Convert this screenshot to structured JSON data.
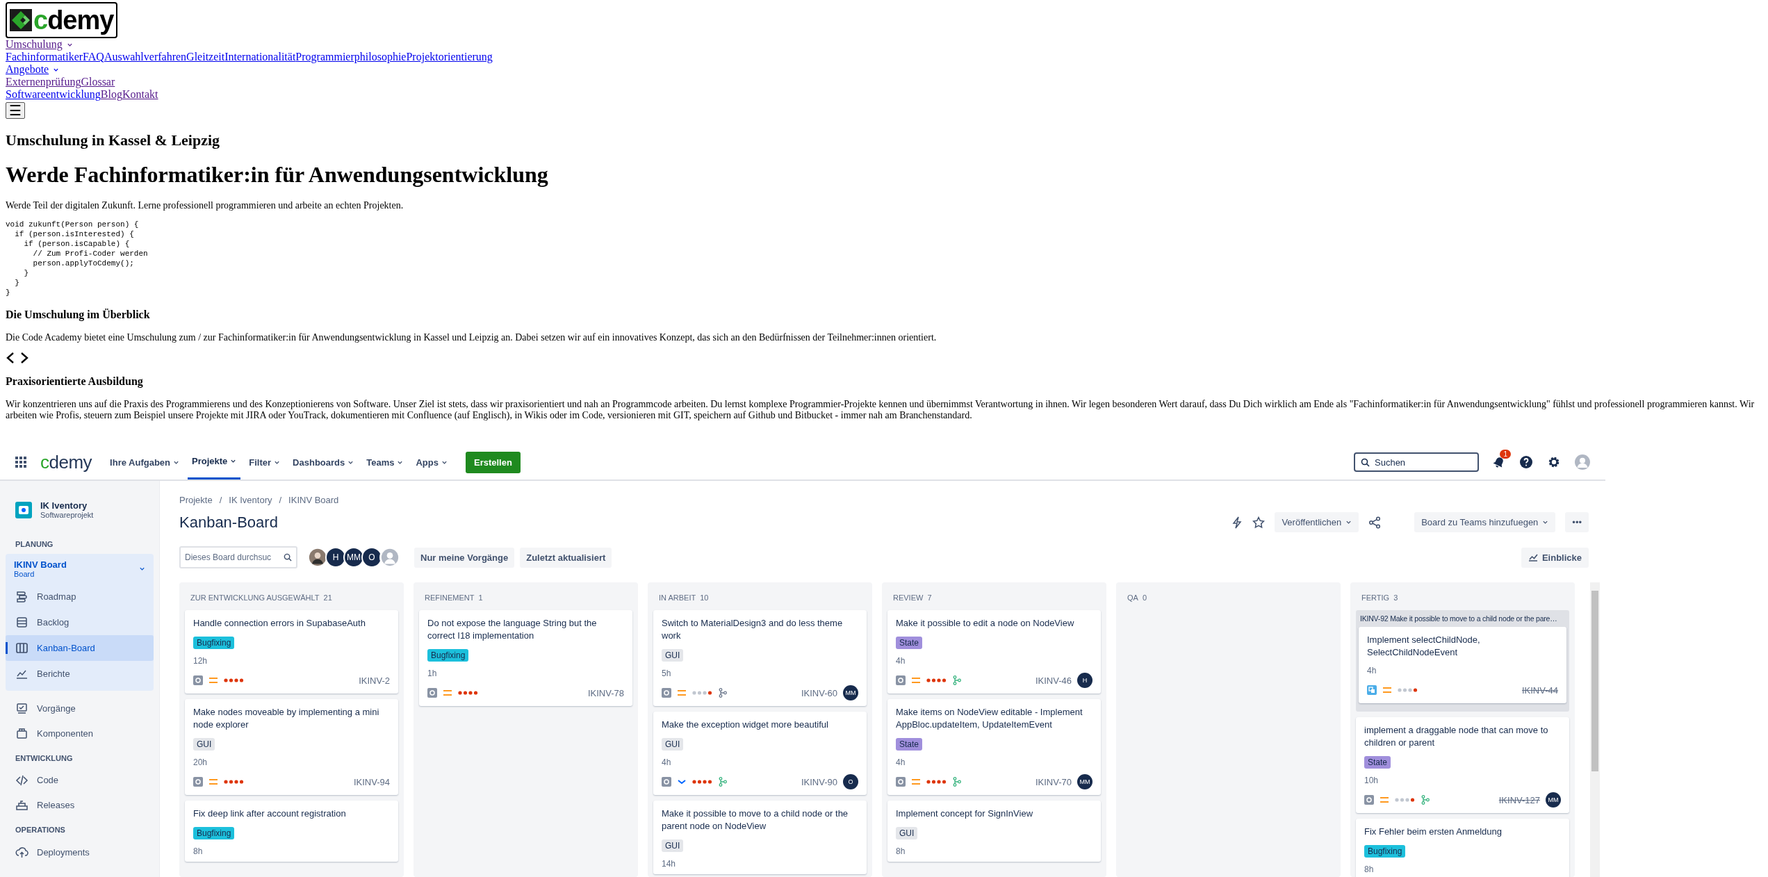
{
  "site": {
    "logo": {
      "text": "cdemy"
    },
    "nav_groups": [
      {
        "menu": {
          "label": "Umschulung",
          "visited": true
        },
        "links": [
          {
            "label": "Fachinformatiker",
            "visited": false
          },
          {
            "label": "FAQ",
            "visited": false
          },
          {
            "label": "Auswahlverfahren",
            "visited": false
          },
          {
            "label": "Gleitzeit",
            "visited": false
          },
          {
            "label": "Internationalität",
            "visited": false
          },
          {
            "label": "Programmierphilosophie",
            "visited": false
          },
          {
            "label": "Projektorientierung",
            "visited": false
          }
        ]
      },
      {
        "menu": {
          "label": "Angebote",
          "visited": false
        },
        "links": [
          {
            "label": "Externenprüfung",
            "visited": true
          },
          {
            "label": "Glossar",
            "visited": true
          }
        ]
      }
    ],
    "nav_links": [
      {
        "label": "Softwareentwicklung",
        "visited": false
      },
      {
        "label": "Blog",
        "visited": true
      },
      {
        "label": "Kontakt",
        "visited": true
      }
    ],
    "menu_button": "☰",
    "eyebrow": "Umschulung in Kassel & Leipzig",
    "headline": "Werde Fachinformatiker:in für Anwendungsentwicklung",
    "intro": "Werde Teil der digitalen Zukunft. Lerne professionell programmieren und arbeite an echten Projekten.",
    "code": "void zukunft(Person person) {\n  if (person.isInterested) {\n    if (person.isCapable) {\n      // Zum Profi-Coder werden\n      person.applyToCdemy();\n    }\n  }\n}",
    "sections": [
      {
        "heading": "Die Umschulung im Überblick",
        "text": "Die Code Academy bietet eine Umschulung zum / zur Fachinformatiker:in für Anwendungsentwicklung in Kassel und Leipzig an. Dabei setzen wir auf ein innovatives Konzept, das sich an den Bedürfnissen der Teilnehmer:innen orientiert.",
        "code_icon": true
      },
      {
        "heading": "Praxisorientierte Ausbildung",
        "text": "Wir konzentrieren uns auf die Praxis des Programmierens und des Konzeptionierens von Software. Unser Ziel ist stets, dass wir praxisorientiert und nah an Programmcode arbeiten. Du lernst komplexe Programmier-Projekte kennen und übernimmst Verantwortung in ihnen. Wir legen besonderen Wert darauf, dass Du Dich wirklich am Ende als \"Fachinformatiker:in für Anwendungsentwicklung\" fühlst und professionell programmieren kannst. Wir arbeiten wie Profis, steuern zum Beispiel unsere Projekte mit JIRA oder YouTrack, dokumentieren mit Confluence (auf Englisch), in Wikis oder im Code, versionieren mit GIT, speichern auf Github und Bitbucket - immer nah am Branchenstandard."
      }
    ]
  },
  "jira": {
    "topbar": {
      "logo": "cdemy",
      "menu": [
        {
          "label": "Ihre Aufgaben",
          "selected": false
        },
        {
          "label": "Projekte",
          "selected": true
        },
        {
          "label": "Filter",
          "selected": false
        },
        {
          "label": "Dashboards",
          "selected": false
        },
        {
          "label": "Teams",
          "selected": false
        },
        {
          "label": "Apps",
          "selected": false
        }
      ],
      "create": "Erstellen",
      "search": {
        "placeholder": "Suchen"
      },
      "notifications": "1"
    },
    "sidebar": {
      "project": {
        "name": "IK Iventory",
        "type": "Softwareprojekt"
      },
      "sections": [
        {
          "title": "PLANUNG",
          "board": {
            "name": "IKINV Board",
            "type": "Board",
            "items": [
              {
                "label": "Roadmap",
                "selected": false
              },
              {
                "label": "Backlog",
                "selected": false
              },
              {
                "label": "Kanban-Board",
                "selected": true
              },
              {
                "label": "Berichte",
                "selected": false
              }
            ]
          },
          "items": [
            {
              "label": "Vorgänge",
              "selected": false
            },
            {
              "label": "Komponenten",
              "selected": false
            }
          ]
        },
        {
          "title": "ENTWICKLUNG",
          "items": [
            {
              "label": "Code",
              "selected": false
            },
            {
              "label": "Releases",
              "selected": false
            }
          ]
        },
        {
          "title": "OPERATIONS",
          "items": [
            {
              "label": "Deployments",
              "selected": false
            }
          ]
        }
      ]
    },
    "breadcrumbs": [
      {
        "text": "Projekte",
        "separator": "/"
      },
      {
        "text": "IK Iventory",
        "separator": "/"
      },
      {
        "text": "IKINV Board"
      }
    ],
    "title": "Kanban-Board",
    "actions": {
      "publish": "Veröffentlichen",
      "teams": "Board zu Teams hinzufuegen",
      "more": "•••"
    },
    "filter": {
      "placeholder": "Dieses Board durchsuc",
      "avatars": [
        {
          "kind": "photo"
        },
        {
          "kind": "initials",
          "text": "H"
        },
        {
          "kind": "initials",
          "text": "MM"
        },
        {
          "kind": "initials",
          "text": "O"
        },
        {
          "kind": "empty"
        }
      ],
      "buttons": [
        "Nur meine Vorgänge",
        "Zuletzt aktualisiert"
      ],
      "insights": "Einblicke"
    },
    "columns": [
      {
        "name": "ZUR ENTWICKLUNG AUSGEWÄHLT",
        "count": "21",
        "cards": [
          {
            "title": "Handle connection errors in SupabaseAuth",
            "label": {
              "text": "Bugfixing",
              "color": "#1cc0dc"
            },
            "time": "12h",
            "icons": [
              {
                "kind": "task"
              },
              {
                "kind": "priority-medium"
              },
              {
                "kind": "dots-all"
              }
            ],
            "key": "IKINV-2",
            "done": false
          },
          {
            "title": "Make nodes moveable by implementing a mini node explorer",
            "label": {
              "text": "GUI",
              "color": "#e4e6ea"
            },
            "time": "20h",
            "icons": [
              {
                "kind": "task"
              },
              {
                "kind": "priority-medium"
              },
              {
                "kind": "dots-all"
              }
            ],
            "key": "IKINV-94",
            "done": false
          },
          {
            "title": "Fix deep link after account registration",
            "label": {
              "text": "Bugfixing",
              "color": "#1cc0dc"
            },
            "time": "8h"
          }
        ]
      },
      {
        "name": "REFINEMENT",
        "count": "1",
        "cards": [
          {
            "title": "Do not expose the language String but the correct I18 implementation",
            "label": {
              "text": "Bugfixing",
              "color": "#1cc0dc"
            },
            "time": "1h",
            "icons": [
              {
                "kind": "task"
              },
              {
                "kind": "priority-medium"
              },
              {
                "kind": "dots-all"
              }
            ],
            "key": "IKINV-78",
            "done": false
          }
        ]
      },
      {
        "name": "IN ARBEIT",
        "count": "10",
        "cards": [
          {
            "title": "Switch to MaterialDesign3 and do less theme work",
            "label": {
              "text": "GUI",
              "color": "#e4e6ea"
            },
            "time": "5h",
            "icons": [
              {
                "kind": "task"
              },
              {
                "kind": "priority-medium"
              },
              {
                "kind": "dots-last"
              },
              {
                "kind": "branch-open"
              }
            ],
            "key": "IKINV-60",
            "assignee": "MM",
            "done": false
          },
          {
            "title": "Make the exception widget more beautiful",
            "label": {
              "text": "GUI",
              "color": "#e4e6ea"
            },
            "time": "4h",
            "icons": [
              {
                "kind": "task"
              },
              {
                "kind": "priority-low"
              },
              {
                "kind": "dots-all"
              },
              {
                "kind": "branch-merged"
              }
            ],
            "key": "IKINV-90",
            "assignee": "O",
            "done": false
          },
          {
            "title": "Make it possible to move to a child node or the parent node on NodeView",
            "label": {
              "text": "GUI",
              "color": "#e4e6ea"
            },
            "time": "14h"
          }
        ]
      },
      {
        "name": "REVIEW",
        "count": "7",
        "cards": [
          {
            "title": "Make it possible to edit a node on NodeView",
            "label": {
              "text": "State",
              "color": "#a08fdc"
            },
            "time": "4h",
            "icons": [
              {
                "kind": "task"
              },
              {
                "kind": "priority-medium"
              },
              {
                "kind": "dots-all"
              },
              {
                "kind": "branch-merged"
              }
            ],
            "key": "IKINV-46",
            "assignee": "H",
            "done": false
          },
          {
            "title": "Make items on NodeView editable - Implement AppBloc.updateItem, UpdateItemEvent",
            "label": {
              "text": "State",
              "color": "#a08fdc"
            },
            "time": "4h",
            "icons": [
              {
                "kind": "task"
              },
              {
                "kind": "priority-medium"
              },
              {
                "kind": "dots-all"
              },
              {
                "kind": "branch-merged"
              }
            ],
            "key": "IKINV-70",
            "assignee": "MM",
            "done": false
          },
          {
            "title": "Implement concept for SignInView",
            "label": {
              "text": "GUI",
              "color": "#e4e6ea"
            },
            "time": "8h"
          }
        ]
      },
      {
        "name": "QA",
        "count": "0"
      },
      {
        "name": "FERTIG",
        "count": "3",
        "group": {
          "title": "IKINV-92 Make it possible to move to a child node or the pare…",
          "cards": [
            {
              "title": "Implement selectChildNode, SelectChildNodeEvent",
              "time": "4h",
              "icons": [
                {
                  "kind": "subtask"
                },
                {
                  "kind": "priority-medium"
                },
                {
                  "kind": "dots-last"
                }
              ],
              "key": "IKINV-44",
              "done": true
            }
          ]
        },
        "cards": [
          {
            "title": "implement a draggable node that can move to children or parent",
            "label": {
              "text": "State",
              "color": "#a08fdc"
            },
            "time": "10h",
            "icons": [
              {
                "kind": "task"
              },
              {
                "kind": "priority-medium"
              },
              {
                "kind": "dots-last"
              },
              {
                "kind": "branch-merged"
              }
            ],
            "key": "IKINV-127",
            "assignee": "MM",
            "done": true
          },
          {
            "title": "Fix Fehler beim ersten Anmeldung",
            "label": {
              "text": "Bugfixing",
              "color": "#1cc0dc"
            },
            "time": "8h"
          }
        ]
      }
    ]
  }
}
